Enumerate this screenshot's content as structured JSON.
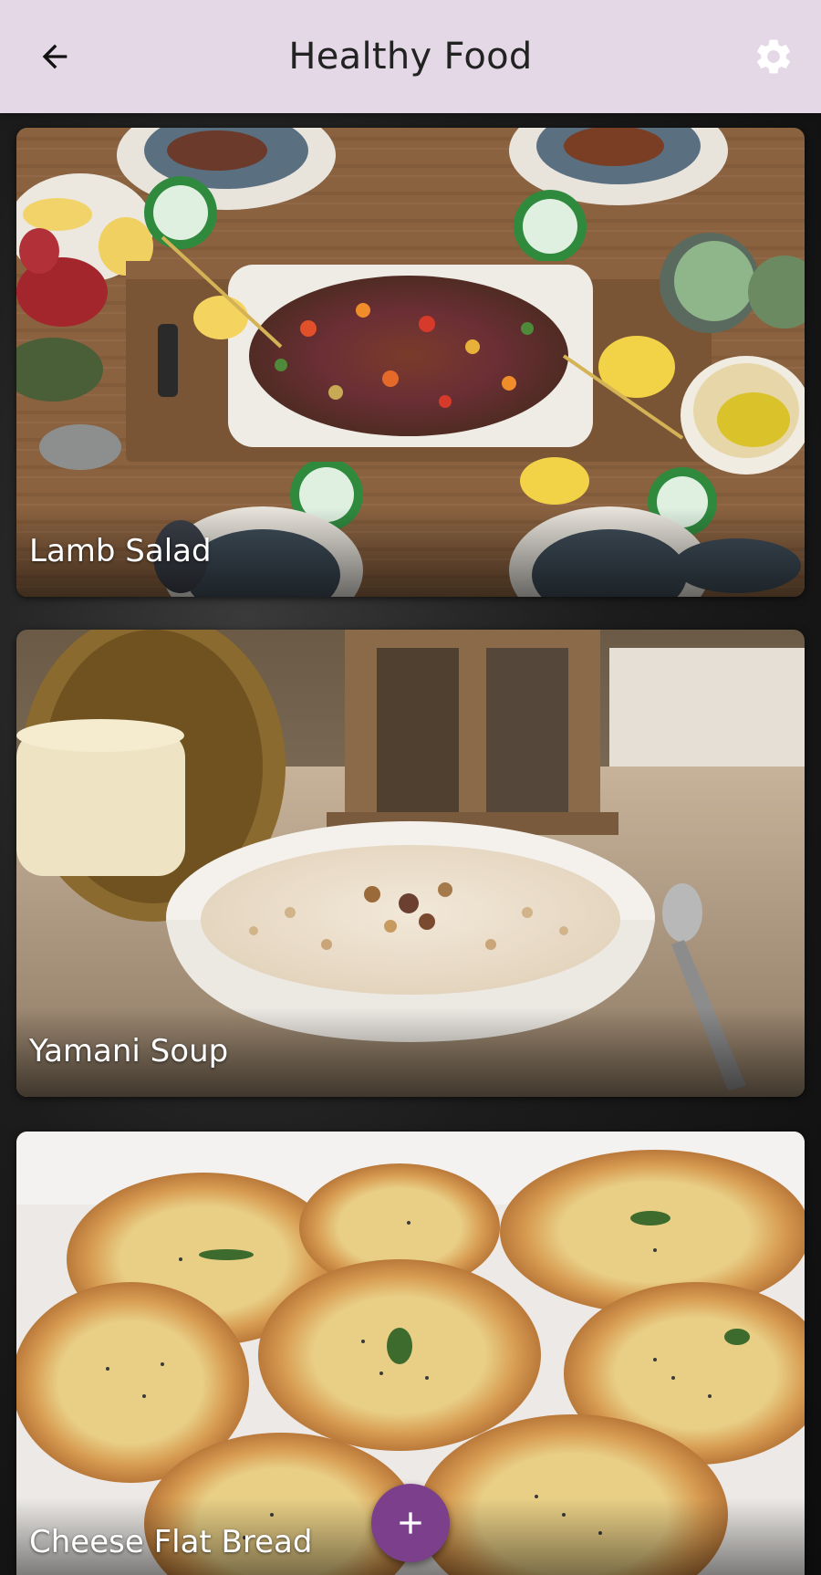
{
  "header": {
    "title": "Healthy Food",
    "background_color": "#e4d8e6",
    "back_icon": "arrow-left-icon",
    "settings_icon": "gear-icon"
  },
  "recipes": [
    {
      "name": "Lamb Salad"
    },
    {
      "name": "Yamani Soup"
    },
    {
      "name": "Cheese Flat Bread"
    }
  ],
  "fab": {
    "icon": "plus-icon",
    "color": "#7b3f8c"
  }
}
